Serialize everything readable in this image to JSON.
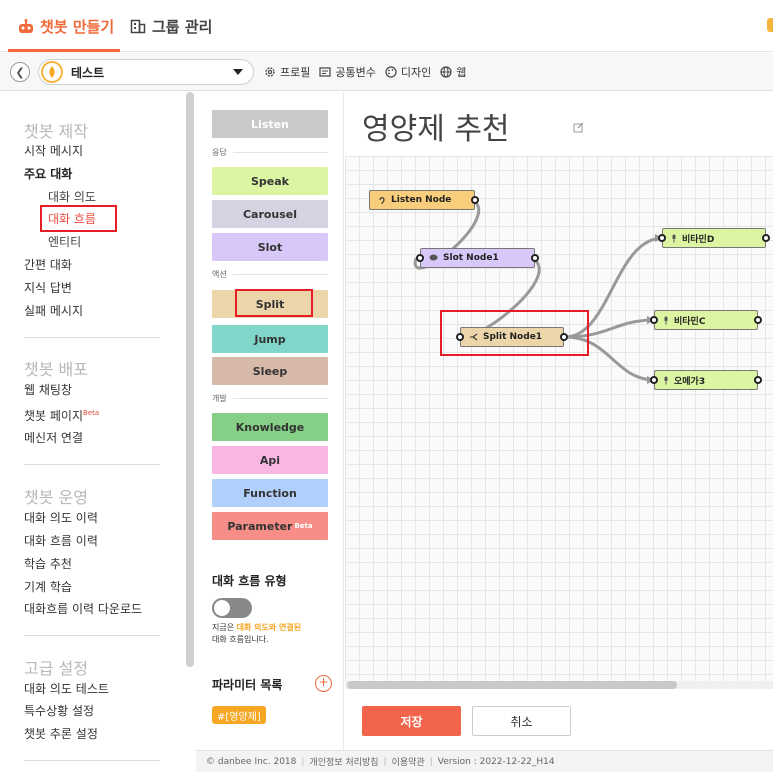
{
  "header": {
    "tabs": [
      {
        "label": "챗봇 만들기",
        "icon": "robot-icon",
        "active": true
      },
      {
        "label": "그룹 관리",
        "icon": "building-icon",
        "active": false
      }
    ],
    "accent_color": "#f06a3b"
  },
  "toolbar": {
    "bot_name": "테스트",
    "links": [
      {
        "label": "프로필",
        "icon": "gear-icon"
      },
      {
        "label": "공통변수",
        "icon": "variable-icon"
      },
      {
        "label": "디자인",
        "icon": "palette-icon"
      },
      {
        "label": "웹",
        "icon": "globe-icon"
      }
    ]
  },
  "sidebar": {
    "build_title": "챗봇 제작",
    "start_message": "시작 메시지",
    "main_dialog": "주요 대화",
    "intent": "대화 의도",
    "flow": "대화 흐름",
    "entity": "엔티티",
    "simple_dialog": "간편 대화",
    "knowledge_answer": "지식 답변",
    "fail_message": "실패 메시지",
    "deploy_title": "챗봇 배포",
    "web_chat": "웹 채팅창",
    "bot_page": "챗봇 페이지",
    "beta": "Beta",
    "messenger": "메신저 연결",
    "operate_title": "챗봇 운영",
    "intent_history": "대화 의도 이력",
    "flow_history": "대화 흐름 이력",
    "learn_recommend": "학습 추천",
    "machine_learning": "기계 학습",
    "flow_history_download": "대화흐름 이력 다운로드",
    "advanced_title": "고급 설정",
    "intent_test": "대화 의도 테스트",
    "special_settings": "특수상황 설정",
    "inference_settings": "챗봇 추론 설정"
  },
  "palette": {
    "listen": "Listen",
    "response_label": "응답",
    "speak": "Speak",
    "carousel": "Carousel",
    "slot": "Slot",
    "action_label": "액션",
    "split": "Split",
    "jump": "Jump",
    "sleep": "Sleep",
    "dev_label": "개발",
    "knowledge": "Knowledge",
    "api": "Api",
    "function": "Function",
    "parameter": "Parameter",
    "beta": "Beta",
    "flow_type_title": "대화 흐름 유형",
    "flow_desc_prefix": "지금은 ",
    "flow_desc_highlight": "대화 의도와 연결된",
    "flow_desc_suffix": "대화 흐름입니다.",
    "param_title": "파라미터 목록",
    "param_chip": "#[영양제]"
  },
  "canvas": {
    "title": "영양제 추천",
    "nodes": {
      "listen": "Listen Node",
      "slot": "Slot Node1",
      "split": "Split Node1",
      "vitd": "비타민D",
      "vitc": "비타민C",
      "omega": "오메가3"
    },
    "save": "저장",
    "cancel": "취소"
  },
  "footer": {
    "copyright": "© danbee Inc. 2018",
    "privacy": "개인정보 처리방침",
    "terms": "이용약관",
    "version": "Version : 2022-12-22_H14"
  }
}
